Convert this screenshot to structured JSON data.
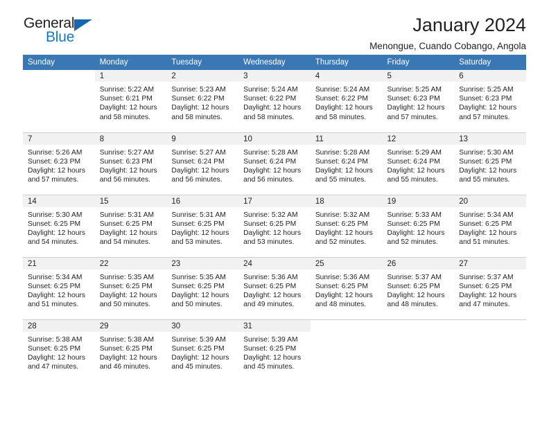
{
  "brand": {
    "name_part1": "General",
    "name_part2": "Blue",
    "triangle_color": "#1567b2",
    "blue_color": "#1b76c4"
  },
  "header": {
    "title": "January 2024",
    "subtitle": "Menongue, Cuando Cobango, Angola",
    "header_bg": "#3a77b5",
    "daynum_band_bg": "#f1f1f1"
  },
  "weekday_headers": [
    "Sunday",
    "Monday",
    "Tuesday",
    "Wednesday",
    "Thursday",
    "Friday",
    "Saturday"
  ],
  "labels": {
    "sunrise_prefix": "Sunrise:",
    "sunset_prefix": "Sunset:",
    "daylight_prefix": "Daylight:"
  },
  "weeks": [
    [
      {
        "day": "",
        "lines": []
      },
      {
        "day": "1",
        "lines": [
          "Sunrise: 5:22 AM",
          "Sunset: 6:21 PM",
          "Daylight: 12 hours",
          "and 58 minutes."
        ]
      },
      {
        "day": "2",
        "lines": [
          "Sunrise: 5:23 AM",
          "Sunset: 6:22 PM",
          "Daylight: 12 hours",
          "and 58 minutes."
        ]
      },
      {
        "day": "3",
        "lines": [
          "Sunrise: 5:24 AM",
          "Sunset: 6:22 PM",
          "Daylight: 12 hours",
          "and 58 minutes."
        ]
      },
      {
        "day": "4",
        "lines": [
          "Sunrise: 5:24 AM",
          "Sunset: 6:22 PM",
          "Daylight: 12 hours",
          "and 58 minutes."
        ]
      },
      {
        "day": "5",
        "lines": [
          "Sunrise: 5:25 AM",
          "Sunset: 6:23 PM",
          "Daylight: 12 hours",
          "and 57 minutes."
        ]
      },
      {
        "day": "6",
        "lines": [
          "Sunrise: 5:25 AM",
          "Sunset: 6:23 PM",
          "Daylight: 12 hours",
          "and 57 minutes."
        ]
      }
    ],
    [
      {
        "day": "7",
        "lines": [
          "Sunrise: 5:26 AM",
          "Sunset: 6:23 PM",
          "Daylight: 12 hours",
          "and 57 minutes."
        ]
      },
      {
        "day": "8",
        "lines": [
          "Sunrise: 5:27 AM",
          "Sunset: 6:23 PM",
          "Daylight: 12 hours",
          "and 56 minutes."
        ]
      },
      {
        "day": "9",
        "lines": [
          "Sunrise: 5:27 AM",
          "Sunset: 6:24 PM",
          "Daylight: 12 hours",
          "and 56 minutes."
        ]
      },
      {
        "day": "10",
        "lines": [
          "Sunrise: 5:28 AM",
          "Sunset: 6:24 PM",
          "Daylight: 12 hours",
          "and 56 minutes."
        ]
      },
      {
        "day": "11",
        "lines": [
          "Sunrise: 5:28 AM",
          "Sunset: 6:24 PM",
          "Daylight: 12 hours",
          "and 55 minutes."
        ]
      },
      {
        "day": "12",
        "lines": [
          "Sunrise: 5:29 AM",
          "Sunset: 6:24 PM",
          "Daylight: 12 hours",
          "and 55 minutes."
        ]
      },
      {
        "day": "13",
        "lines": [
          "Sunrise: 5:30 AM",
          "Sunset: 6:25 PM",
          "Daylight: 12 hours",
          "and 55 minutes."
        ]
      }
    ],
    [
      {
        "day": "14",
        "lines": [
          "Sunrise: 5:30 AM",
          "Sunset: 6:25 PM",
          "Daylight: 12 hours",
          "and 54 minutes."
        ]
      },
      {
        "day": "15",
        "lines": [
          "Sunrise: 5:31 AM",
          "Sunset: 6:25 PM",
          "Daylight: 12 hours",
          "and 54 minutes."
        ]
      },
      {
        "day": "16",
        "lines": [
          "Sunrise: 5:31 AM",
          "Sunset: 6:25 PM",
          "Daylight: 12 hours",
          "and 53 minutes."
        ]
      },
      {
        "day": "17",
        "lines": [
          "Sunrise: 5:32 AM",
          "Sunset: 6:25 PM",
          "Daylight: 12 hours",
          "and 53 minutes."
        ]
      },
      {
        "day": "18",
        "lines": [
          "Sunrise: 5:32 AM",
          "Sunset: 6:25 PM",
          "Daylight: 12 hours",
          "and 52 minutes."
        ]
      },
      {
        "day": "19",
        "lines": [
          "Sunrise: 5:33 AM",
          "Sunset: 6:25 PM",
          "Daylight: 12 hours",
          "and 52 minutes."
        ]
      },
      {
        "day": "20",
        "lines": [
          "Sunrise: 5:34 AM",
          "Sunset: 6:25 PM",
          "Daylight: 12 hours",
          "and 51 minutes."
        ]
      }
    ],
    [
      {
        "day": "21",
        "lines": [
          "Sunrise: 5:34 AM",
          "Sunset: 6:25 PM",
          "Daylight: 12 hours",
          "and 51 minutes."
        ]
      },
      {
        "day": "22",
        "lines": [
          "Sunrise: 5:35 AM",
          "Sunset: 6:25 PM",
          "Daylight: 12 hours",
          "and 50 minutes."
        ]
      },
      {
        "day": "23",
        "lines": [
          "Sunrise: 5:35 AM",
          "Sunset: 6:25 PM",
          "Daylight: 12 hours",
          "and 50 minutes."
        ]
      },
      {
        "day": "24",
        "lines": [
          "Sunrise: 5:36 AM",
          "Sunset: 6:25 PM",
          "Daylight: 12 hours",
          "and 49 minutes."
        ]
      },
      {
        "day": "25",
        "lines": [
          "Sunrise: 5:36 AM",
          "Sunset: 6:25 PM",
          "Daylight: 12 hours",
          "and 48 minutes."
        ]
      },
      {
        "day": "26",
        "lines": [
          "Sunrise: 5:37 AM",
          "Sunset: 6:25 PM",
          "Daylight: 12 hours",
          "and 48 minutes."
        ]
      },
      {
        "day": "27",
        "lines": [
          "Sunrise: 5:37 AM",
          "Sunset: 6:25 PM",
          "Daylight: 12 hours",
          "and 47 minutes."
        ]
      }
    ],
    [
      {
        "day": "28",
        "lines": [
          "Sunrise: 5:38 AM",
          "Sunset: 6:25 PM",
          "Daylight: 12 hours",
          "and 47 minutes."
        ]
      },
      {
        "day": "29",
        "lines": [
          "Sunrise: 5:38 AM",
          "Sunset: 6:25 PM",
          "Daylight: 12 hours",
          "and 46 minutes."
        ]
      },
      {
        "day": "30",
        "lines": [
          "Sunrise: 5:39 AM",
          "Sunset: 6:25 PM",
          "Daylight: 12 hours",
          "and 45 minutes."
        ]
      },
      {
        "day": "31",
        "lines": [
          "Sunrise: 5:39 AM",
          "Sunset: 6:25 PM",
          "Daylight: 12 hours",
          "and 45 minutes."
        ]
      },
      {
        "day": "",
        "lines": []
      },
      {
        "day": "",
        "lines": []
      },
      {
        "day": "",
        "lines": []
      }
    ]
  ]
}
